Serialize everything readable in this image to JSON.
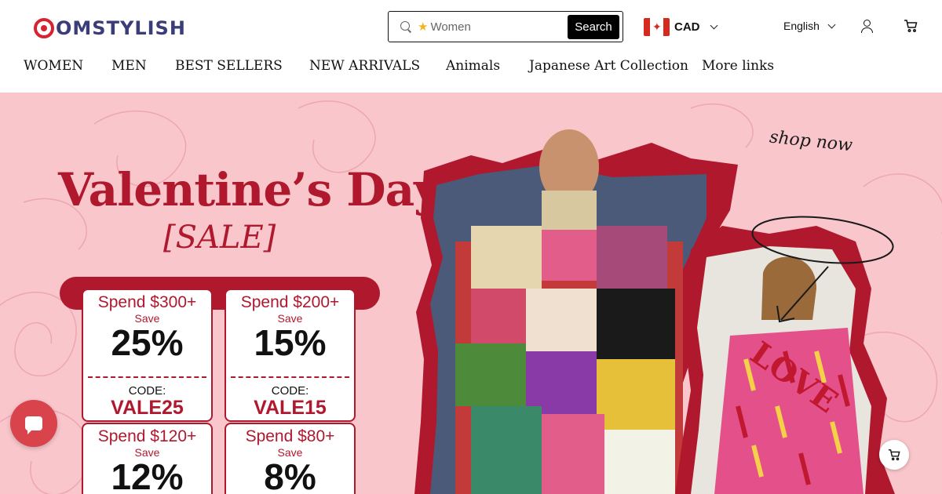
{
  "header": {
    "logo_text": "OMSTYLISH",
    "search": {
      "placeholder": "Women",
      "button_label": "Search",
      "icon": "search-icon",
      "star_icon": "star-icon"
    },
    "currency": {
      "code": "CAD",
      "flag": "canada-flag-icon"
    },
    "language": {
      "label": "English"
    },
    "icons": [
      "user-icon",
      "cart-icon"
    ]
  },
  "nav": {
    "items": [
      "WOMEN",
      "MEN",
      "BEST SELLERS",
      "NEW ARRIVALS",
      "Animals",
      "Japanese Art Collection",
      "More links"
    ]
  },
  "banner": {
    "title": "Valentine’s Day",
    "subtitle": "[SALE]",
    "shop_now": "shop now",
    "coupons": [
      {
        "spend": "Spend $300+",
        "save": "Save",
        "discount": "25%",
        "code_label": "CODE:",
        "code": "VALE25"
      },
      {
        "spend": "Spend $200+",
        "save": "Save",
        "discount": "15%",
        "code_label": "CODE:",
        "code": "VALE15"
      },
      {
        "spend": "Spend $120+",
        "save": "Save",
        "discount": "12%"
      },
      {
        "spend": "Spend $80+",
        "save": "Save",
        "discount": "8%"
      }
    ],
    "shirt_text": "LOVE",
    "colors": {
      "background": "#f8c6cb",
      "accent": "#b0182e"
    }
  },
  "floating": {
    "chat_icon": "chat-icon",
    "cart_icon": "cart-icon"
  }
}
